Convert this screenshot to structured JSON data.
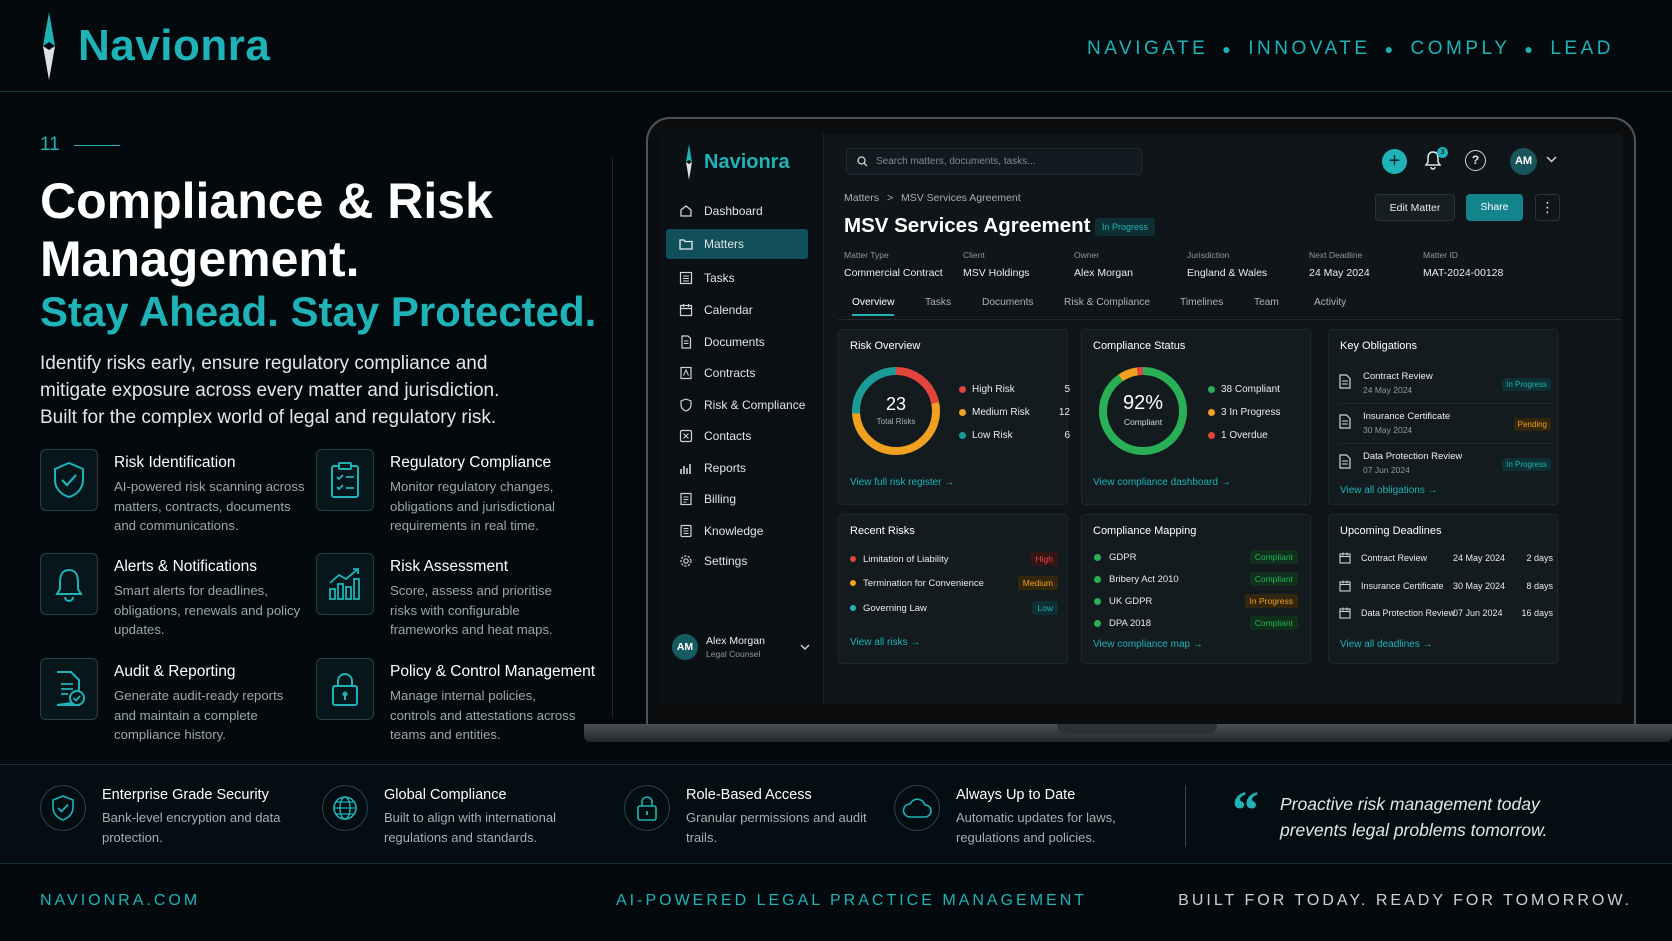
{
  "header": {
    "brand": "Navionra",
    "tagline": [
      "NAVIGATE",
      "INNOVATE",
      "COMPLY",
      "LEAD"
    ]
  },
  "hero": {
    "section_number": "11",
    "title": "Compliance & Risk Management.",
    "subtitle": "Stay Ahead. Stay Protected.",
    "intro": "Identify risks early, ensure regulatory compliance and mitigate exposure across every matter and jurisdiction. Built for the complex world of legal and regulatory risk."
  },
  "features": [
    {
      "title": "Risk Identification",
      "desc": "AI-powered risk scanning across matters, contracts, documents and communications.",
      "icon": "shield-check-icon"
    },
    {
      "title": "Regulatory Compliance",
      "desc": "Monitor regulatory changes, obligations and jurisdictional requirements in real time.",
      "icon": "clipboard-checklist-icon"
    },
    {
      "title": "Alerts & Notifications",
      "desc": "Smart alerts for deadlines, obligations, renewals and policy updates.",
      "icon": "bell-icon"
    },
    {
      "title": "Risk Assessment",
      "desc": "Score, assess and prioritise risks with configurable frameworks and heat maps.",
      "icon": "bar-chart-trend-icon"
    },
    {
      "title": "Audit & Reporting",
      "desc": "Generate audit-ready reports and maintain a complete compliance history.",
      "icon": "document-check-icon"
    },
    {
      "title": "Policy & Control Management",
      "desc": "Manage internal policies, controls and attestations across teams and entities.",
      "icon": "padlock-icon"
    }
  ],
  "app": {
    "brand": "Navionra",
    "search_placeholder": "Search matters, documents, tasks...",
    "notification_count": "3",
    "user_initials": "AM",
    "nav": [
      {
        "label": "Dashboard",
        "icon": "home-icon"
      },
      {
        "label": "Matters",
        "icon": "folder-icon",
        "active": true
      },
      {
        "label": "Tasks",
        "icon": "list-icon"
      },
      {
        "label": "Calendar",
        "icon": "calendar-icon"
      },
      {
        "label": "Documents",
        "icon": "document-icon"
      },
      {
        "label": "Contracts",
        "icon": "contract-icon"
      },
      {
        "label": "Risk & Compliance",
        "icon": "shield-icon"
      },
      {
        "label": "Contacts",
        "icon": "contact-icon"
      },
      {
        "label": "Reports",
        "icon": "reports-icon"
      },
      {
        "label": "Billing",
        "icon": "billing-icon"
      },
      {
        "label": "Knowledge",
        "icon": "knowledge-icon"
      },
      {
        "label": "Settings",
        "icon": "gear-icon"
      }
    ],
    "user": {
      "initials": "AM",
      "name": "Alex Morgan",
      "role": "Legal Counsel"
    },
    "breadcrumb": {
      "parent": "Matters",
      "sep": ">",
      "current": "MSV Services Agreement"
    },
    "matter": {
      "title": "MSV Services Agreement",
      "status": "In Progress",
      "edit_label": "Edit Matter",
      "share_label": "Share",
      "more_label": "⋮",
      "meta": [
        {
          "key": "Matter Type",
          "value": "Commercial Contract"
        },
        {
          "key": "Client",
          "value": "MSV Holdings"
        },
        {
          "key": "Owner",
          "value": "Alex Morgan"
        },
        {
          "key": "Jurisdiction",
          "value": "England & Wales"
        },
        {
          "key": "Next Deadline",
          "value": "24 May 2024"
        },
        {
          "key": "Matter ID",
          "value": "MAT-2024-00128"
        }
      ]
    },
    "tabs": [
      "Overview",
      "Tasks",
      "Documents",
      "Risk & Compliance",
      "Timelines",
      "Team",
      "Activity"
    ],
    "risk_overview": {
      "title": "Risk Overview",
      "total": "23",
      "total_label": "Total Risks",
      "items": [
        {
          "label": "High Risk",
          "value": 5,
          "color": "#e2453c"
        },
        {
          "label": "Medium Risk",
          "value": 12,
          "color": "#f0a11f"
        },
        {
          "label": "Low Risk",
          "value": 6,
          "color": "#1d9a95"
        }
      ],
      "link": "View full risk register"
    },
    "compliance_status": {
      "title": "Compliance Status",
      "percent": "92%",
      "percent_label": "Compliant",
      "items": [
        {
          "label": "38 Compliant",
          "value": 38,
          "color": "#29b056"
        },
        {
          "label": "3  In Progress",
          "value": 3,
          "color": "#f0a11f"
        },
        {
          "label": "1  Overdue",
          "value": 1,
          "color": "#e2453c"
        }
      ],
      "link": "View compliance dashboard"
    },
    "key_obligations": {
      "title": "Key Obligations",
      "items": [
        {
          "name": "Contract Review",
          "date": "24 May 2024",
          "status": "In Progress",
          "color": "#1fb3b8",
          "bg": "#0e2f34"
        },
        {
          "name": "Insurance Certificate",
          "date": "30 May 2024",
          "status": "Pending",
          "color": "#f0a11f",
          "bg": "#33260e"
        },
        {
          "name": "Data Protection Review",
          "date": "07 Jun 2024",
          "status": "In Progress",
          "color": "#1fb3b8",
          "bg": "#0e2f34"
        }
      ],
      "link": "View all obligations"
    },
    "recent_risks": {
      "title": "Recent Risks",
      "items": [
        {
          "name": "Limitation of Liability",
          "level": "High",
          "color": "#e2453c",
          "bg": "#351516"
        },
        {
          "name": "Termination for Convenience",
          "level": "Medium",
          "color": "#f0a11f",
          "bg": "#33260e"
        },
        {
          "name": "Governing Law",
          "level": "Low",
          "color": "#1fb3b8",
          "bg": "#0e2f34"
        }
      ],
      "link": "View all risks"
    },
    "compliance_mapping": {
      "title": "Compliance Mapping",
      "items": [
        {
          "name": "GDPR",
          "status": "Compliant",
          "color": "#29b056",
          "bg": "#10301c"
        },
        {
          "name": "Bribery Act 2010",
          "status": "Compliant",
          "color": "#29b056",
          "bg": "#10301c"
        },
        {
          "name": "UK GDPR",
          "status": "In Progress",
          "color": "#f0a11f",
          "bg": "#33260e"
        },
        {
          "name": "DPA 2018",
          "status": "Compliant",
          "color": "#29b056",
          "bg": "#10301c"
        }
      ],
      "link": "View compliance map"
    },
    "upcoming_deadlines": {
      "title": "Upcoming Deadlines",
      "items": [
        {
          "name": "Contract Review",
          "date": "24 May 2024",
          "remaining": "2 days"
        },
        {
          "name": "Insurance Certificate",
          "date": "30 May 2024",
          "remaining": "8 days"
        },
        {
          "name": "Data Protection Review",
          "date": "07 Jun 2024",
          "remaining": "16 days"
        }
      ],
      "link": "View all deadlines"
    }
  },
  "strip": [
    {
      "title": "Enterprise Grade Security",
      "desc": "Bank-level encryption and data protection.",
      "icon": "shield-check-icon"
    },
    {
      "title": "Global Compliance",
      "desc": "Built to align with international regulations and standards.",
      "icon": "globe-icon"
    },
    {
      "title": "Role-Based Access",
      "desc": "Granular permissions and audit trails.",
      "icon": "padlock-icon"
    },
    {
      "title": "Always Up to Date",
      "desc": "Automatic updates for laws, regulations and policies.",
      "icon": "cloud-icon"
    }
  ],
  "quote": {
    "mark": "“",
    "text": "Proactive risk management today prevents legal problems tomorrow."
  },
  "footer": {
    "website": "NAVIONRA.COM",
    "product": "AI-POWERED LEGAL PRACTICE MANAGEMENT",
    "slogan": "BUILT FOR TODAY. READY FOR TOMORROW."
  },
  "colors": {
    "accent": "#1fb3b8",
    "background": "#03090d",
    "high": "#e2453c",
    "medium": "#f0a11f",
    "low": "#1d9a95",
    "compliant": "#29b056"
  }
}
